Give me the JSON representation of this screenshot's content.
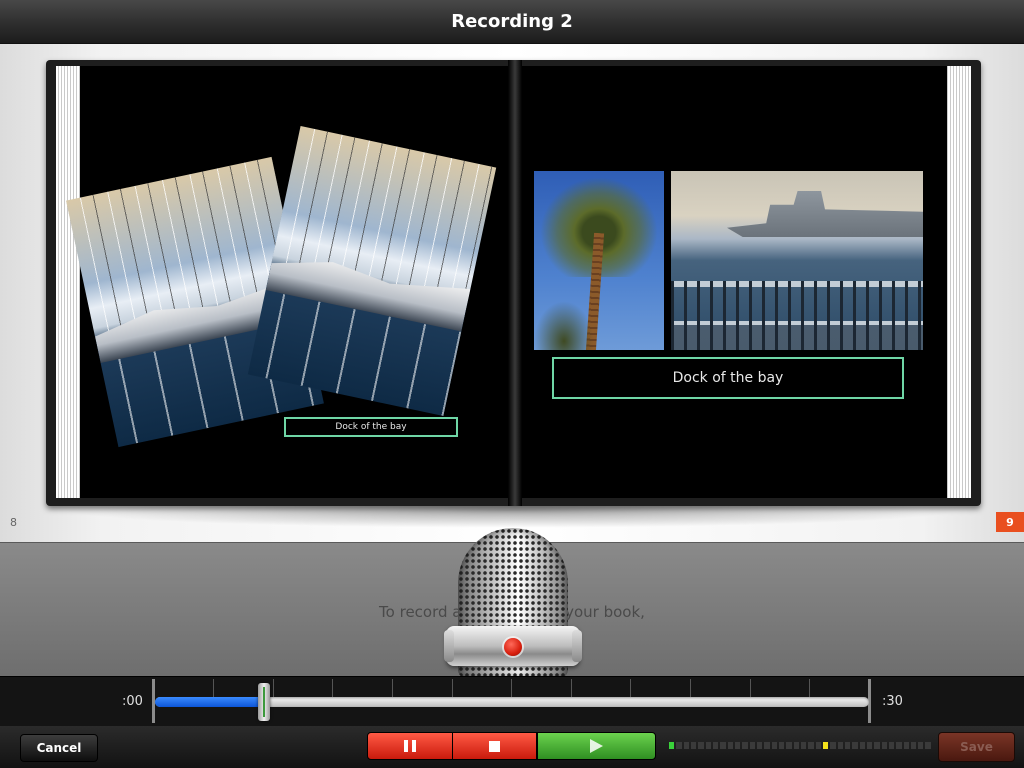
{
  "title": "Recording 2",
  "book": {
    "left_page_number": "8",
    "right_page_number": "9",
    "left_caption": "Dock of the bay",
    "right_caption": "Dock of the bay",
    "photos": [
      "sailboats-photo",
      "yacht-photo",
      "palm-tree-photo",
      "bay-ship-photo"
    ]
  },
  "recording": {
    "hint": "To record a narration for your book,",
    "start_time": ":00",
    "end_time": ":30",
    "progress_fraction": 0.152
  },
  "toolbar": {
    "cancel_label": "Cancel",
    "save_label": "Save",
    "pause_icon": "pause-icon",
    "stop_icon": "stop-icon",
    "play_icon": "play-icon",
    "level_segments": 36,
    "level_green_index": 0,
    "level_yellow_index": 21
  },
  "colors": {
    "record_red": "#d81f0e",
    "play_green": "#2f8f22",
    "accent_orange": "#e94f1f",
    "caption_border": "#6fd6a6",
    "progress_blue": "#0d56d8"
  }
}
